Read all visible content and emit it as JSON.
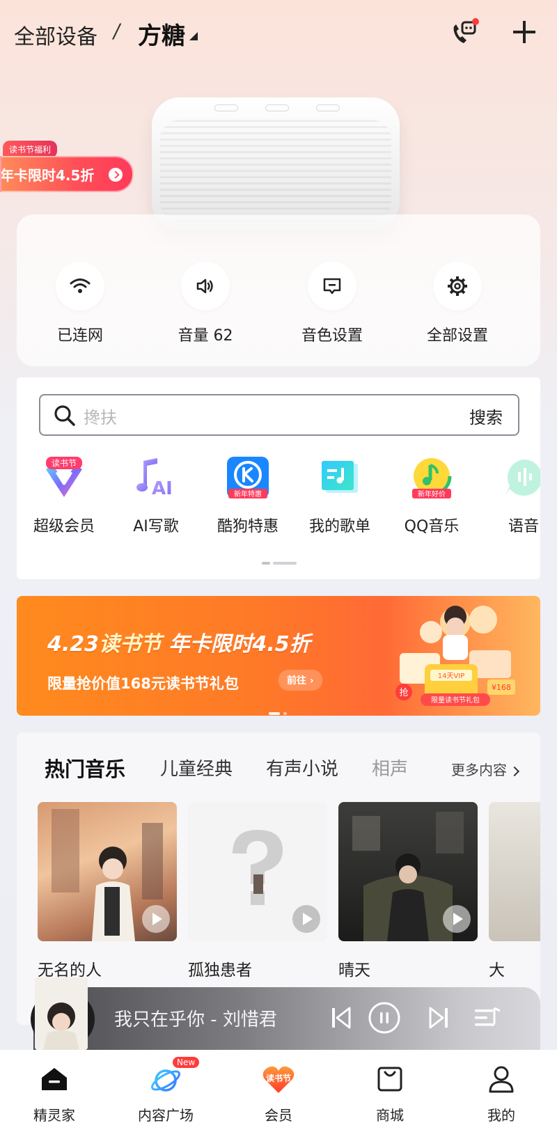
{
  "header": {
    "crumb_all": "全部设备",
    "crumb_sep": "/",
    "device_name": "方糖"
  },
  "promo": {
    "tag": "读书节福利",
    "text": "年卡限时4.5折"
  },
  "status": [
    {
      "label": "已连网",
      "icon": "wifi-icon"
    },
    {
      "label": "音量 62",
      "icon": "volume-icon"
    },
    {
      "label": "音色设置",
      "icon": "message-icon"
    },
    {
      "label": "全部设置",
      "icon": "gear-icon"
    }
  ],
  "search": {
    "placeholder": "搀扶",
    "button": "搜索"
  },
  "apps": [
    {
      "label": "超级会员",
      "badge": "读书节",
      "icon": "vip-icon"
    },
    {
      "label": "AI写歌",
      "icon": "ai-music-icon"
    },
    {
      "label": "酷狗特惠",
      "badge": "新年特惠",
      "icon": "kugou-icon"
    },
    {
      "label": "我的歌单",
      "icon": "playlist-icon"
    },
    {
      "label": "QQ音乐",
      "badge": "新年好价",
      "icon": "qqmusic-icon"
    },
    {
      "label": "语音",
      "icon": "voice-icon"
    }
  ],
  "banner": {
    "date": "4.23",
    "event": "读书节",
    "headline_rest": " 年卡限时4.5折",
    "subline": "限量抢价值168元读书节礼包",
    "cta": "前往",
    "art_vip": "14天VIP",
    "art_price": "¥168",
    "art_tag": "限量读书节礼包",
    "art_grab": "抢"
  },
  "music": {
    "tabs": [
      "热门音乐",
      "儿童经典",
      "有声小说",
      "相声"
    ],
    "more": "更多内容",
    "albums": [
      {
        "title": "无名的人"
      },
      {
        "title": "孤独患者"
      },
      {
        "title": "晴天"
      },
      {
        "title": "大"
      }
    ]
  },
  "player": {
    "now_playing": "我只在乎你 - 刘惜君"
  },
  "nav": [
    {
      "label": "精灵家",
      "icon": "home-icon"
    },
    {
      "label": "内容广场",
      "icon": "planet-icon",
      "badge": "New"
    },
    {
      "label": "会员",
      "icon": "member-heart-icon",
      "badge": "读书节"
    },
    {
      "label": "商城",
      "icon": "shop-bag-icon"
    },
    {
      "label": "我的",
      "icon": "profile-icon"
    }
  ],
  "colors": {
    "accent_red": "#ff4d57",
    "banner_orange": "#ff7a27",
    "badge_red": "#ff3b3b"
  }
}
